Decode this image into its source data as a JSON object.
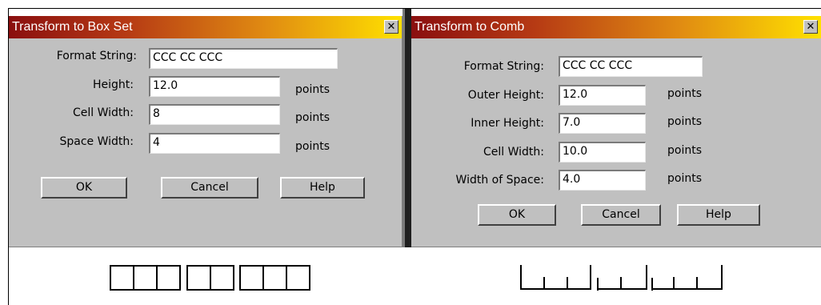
{
  "box_set_dialog": {
    "title": "Transform to Box Set",
    "close_glyph": "✕",
    "fields": [
      {
        "label": "Format String:",
        "value": "CCC CC CCC",
        "unit": ""
      },
      {
        "label": "Height:",
        "value": "12.0",
        "unit": "points"
      },
      {
        "label": "Cell Width:",
        "value": "8",
        "unit": "points"
      },
      {
        "label": "Space Width:",
        "value": "4",
        "unit": "points"
      }
    ],
    "buttons": {
      "ok": "OK",
      "cancel": "Cancel",
      "help": "Help"
    }
  },
  "comb_dialog": {
    "title": "Transform to Comb",
    "close_glyph": "✕",
    "fields": [
      {
        "label": "Format String:",
        "value": "CCC CC CCC",
        "unit": ""
      },
      {
        "label": "Outer Height:",
        "value": "12.0",
        "unit": "points"
      },
      {
        "label": "Inner Height:",
        "value": "7.0",
        "unit": "points"
      },
      {
        "label": "Cell Width:",
        "value": "10.0",
        "unit": "points"
      },
      {
        "label": "Width of Space:",
        "value": "4.0",
        "unit": "points"
      }
    ],
    "buttons": {
      "ok": "OK",
      "cancel": "Cancel",
      "help": "Help"
    }
  },
  "icons": {
    "close": "close-icon"
  },
  "colors": {
    "dialog_bg": "#c0c0c0",
    "title_gradient_start": "#8a0f0f",
    "title_gradient_end": "#ffe100",
    "title_text": "#ffffff"
  }
}
